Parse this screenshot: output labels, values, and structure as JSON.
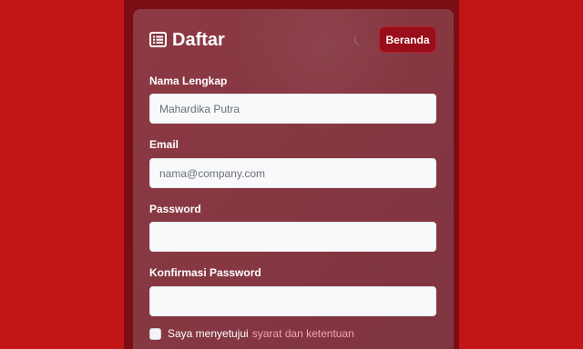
{
  "header": {
    "title": "Daftar",
    "title_icon": "list-icon",
    "theme_icon": "moon-icon",
    "home_label": "Beranda"
  },
  "form": {
    "full_name": {
      "label": "Nama Lengkap",
      "placeholder": "Mahardika Putra",
      "value": ""
    },
    "email": {
      "label": "Email",
      "placeholder": "nama@company.com",
      "value": ""
    },
    "password": {
      "label": "Password",
      "placeholder": "",
      "value": ""
    },
    "confirm_password": {
      "label": "Konfirmasi Password",
      "placeholder": "",
      "value": ""
    },
    "agree": {
      "checked": false,
      "text": "Saya menyetujui",
      "link_text": "syarat dan ketentuan"
    }
  },
  "colors": {
    "background": "#c21616",
    "column": "#7a0e14",
    "card": "#8c3a44",
    "button": "#9a0d1a",
    "link": "#f2a5ab"
  }
}
